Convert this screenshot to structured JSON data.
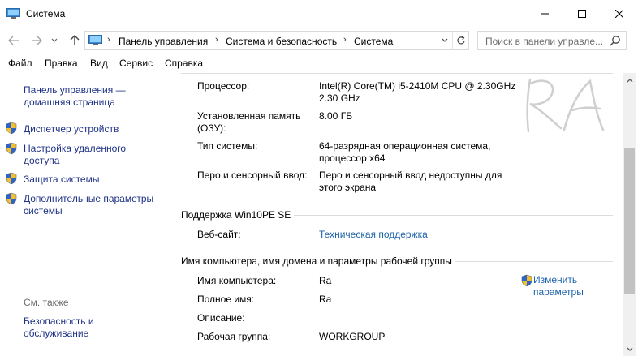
{
  "window": {
    "title": "Система"
  },
  "address": {
    "crumbs": [
      "Панель управления",
      "Система и безопасность",
      "Система"
    ]
  },
  "search": {
    "placeholder": "Поиск в панели управле..."
  },
  "menu": {
    "items": [
      "Файл",
      "Правка",
      "Вид",
      "Сервис",
      "Справка"
    ]
  },
  "sidebar": {
    "home_line1": "Панель управления —",
    "home_line2": "домашняя страница",
    "items": [
      {
        "line1": "Диспетчер устройств",
        "line2": ""
      },
      {
        "line1": "Настройка удаленного",
        "line2": "доступа"
      },
      {
        "line1": "Защита системы",
        "line2": ""
      },
      {
        "line1": "Дополнительные параметры",
        "line2": "системы"
      }
    ],
    "see_also": "См. также",
    "see_also_link_line1": "Безопасность и",
    "see_also_link_line2": "обслуживание"
  },
  "system_info": {
    "processor_label": "Процессор:",
    "processor_value_line1": "Intel(R) Core(TM) i5-2410M CPU @ 2.30GHz",
    "processor_value_line2": "2.30 GHz",
    "memory_label_line1": "Установленная память",
    "memory_label_line2": "(ОЗУ):",
    "memory_value": "8.00 ГБ",
    "type_label": "Тип системы:",
    "type_value_line1": "64-разрядная операционная система,",
    "type_value_line2": "процессор x64",
    "pen_label": "Перо и сенсорный ввод:",
    "pen_value_line1": "Перо и сенсорный ввод недоступны для",
    "pen_value_line2": "этого экрана"
  },
  "support": {
    "section_title": "Поддержка Win10PE SE",
    "website_label": "Веб-сайт:",
    "website_link": "Техническая поддержка"
  },
  "computer": {
    "section_title": "Имя компьютера, имя домена и параметры рабочей группы",
    "name_label": "Имя компьютера:",
    "name_value": "Ra",
    "fullname_label": "Полное имя:",
    "fullname_value": "Ra",
    "description_label": "Описание:",
    "workgroup_label": "Рабочая группа:",
    "workgroup_value": "WORKGROUP",
    "change_line1": "Изменить",
    "change_line2": "параметры"
  },
  "colors": {
    "link": "#1e64aa",
    "nav_link": "#1e3287",
    "muted": "#6d6d6d"
  }
}
